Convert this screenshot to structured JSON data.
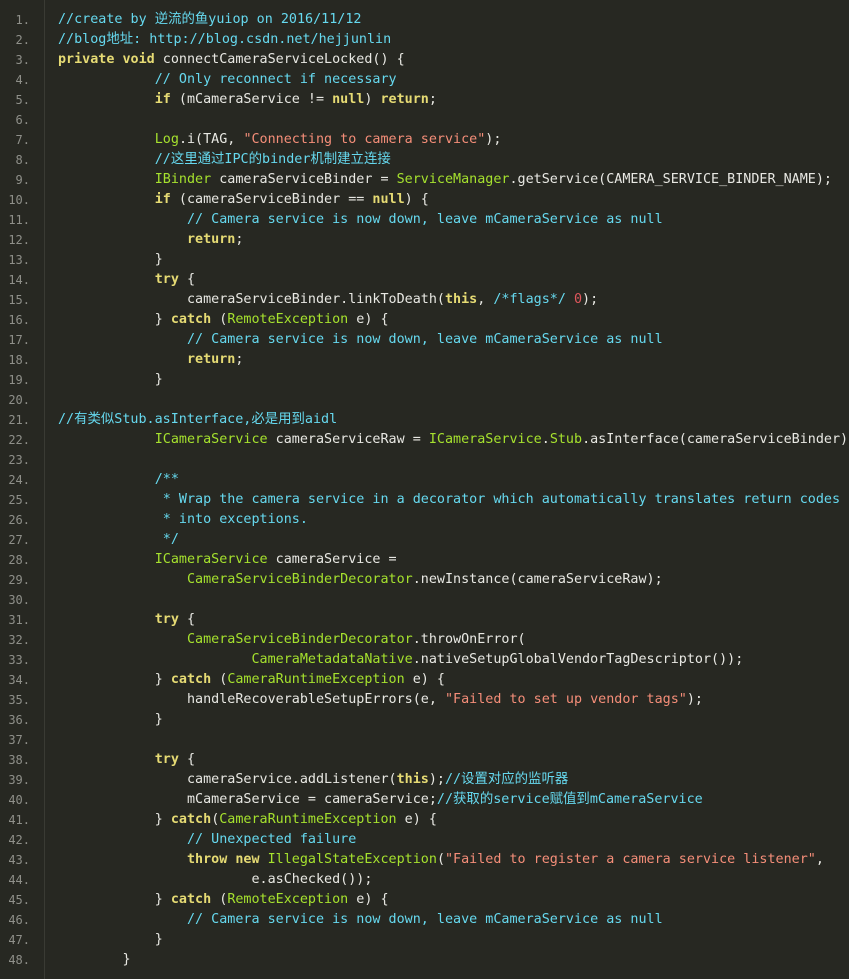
{
  "theme": {
    "background": "#272822",
    "line_number": "#8f908a",
    "plain": "#e8e8e3",
    "comment": "#66d9ef",
    "keyword": "#e6db74",
    "class_name": "#a6e22e",
    "string": "#f58e79",
    "number": "#e0575c"
  },
  "code": {
    "lines": [
      {
        "n": "1.",
        "tokens": [
          [
            "c",
            "//create by 逆流的鱼yuiop on 2016/11/12"
          ]
        ]
      },
      {
        "n": "2.",
        "tokens": [
          [
            "c",
            "//blog地址: http://blog.csdn.net/hejjunlin"
          ]
        ]
      },
      {
        "n": "3.",
        "tokens": [
          [
            "k",
            "private void"
          ],
          [
            "p",
            " connectCameraServiceLocked() {"
          ]
        ]
      },
      {
        "n": "4.",
        "tokens": [
          [
            "p",
            "            "
          ],
          [
            "c",
            "// Only reconnect if necessary"
          ]
        ]
      },
      {
        "n": "5.",
        "tokens": [
          [
            "p",
            "            "
          ],
          [
            "k",
            "if"
          ],
          [
            "p",
            " (mCameraService != "
          ],
          [
            "k",
            "null"
          ],
          [
            "p",
            ") "
          ],
          [
            "k",
            "return"
          ],
          [
            "p",
            ";"
          ]
        ]
      },
      {
        "n": "6.",
        "tokens": [
          [
            "p",
            ""
          ]
        ]
      },
      {
        "n": "7.",
        "tokens": [
          [
            "p",
            "            "
          ],
          [
            "n",
            "Log"
          ],
          [
            "p",
            ".i(TAG, "
          ],
          [
            "s",
            "\"Connecting to camera service\""
          ],
          [
            "p",
            ");"
          ]
        ]
      },
      {
        "n": "8.",
        "tokens": [
          [
            "p",
            "            "
          ],
          [
            "c",
            "//这里通过IPC的binder机制建立连接"
          ]
        ]
      },
      {
        "n": "9.",
        "tokens": [
          [
            "p",
            "            "
          ],
          [
            "n",
            "IBinder"
          ],
          [
            "p",
            " cameraServiceBinder = "
          ],
          [
            "n",
            "ServiceManager"
          ],
          [
            "p",
            ".getService(CAMERA_SERVICE_BINDER_NAME);"
          ]
        ]
      },
      {
        "n": "10.",
        "tokens": [
          [
            "p",
            "            "
          ],
          [
            "k",
            "if"
          ],
          [
            "p",
            " (cameraServiceBinder == "
          ],
          [
            "k",
            "null"
          ],
          [
            "p",
            ") {"
          ]
        ]
      },
      {
        "n": "11.",
        "tokens": [
          [
            "p",
            "                "
          ],
          [
            "c",
            "// Camera service is now down, leave mCameraService as null"
          ]
        ]
      },
      {
        "n": "12.",
        "tokens": [
          [
            "p",
            "                "
          ],
          [
            "k",
            "return"
          ],
          [
            "p",
            ";"
          ]
        ]
      },
      {
        "n": "13.",
        "tokens": [
          [
            "p",
            "            }"
          ]
        ]
      },
      {
        "n": "14.",
        "tokens": [
          [
            "p",
            "            "
          ],
          [
            "k",
            "try"
          ],
          [
            "p",
            " {"
          ]
        ]
      },
      {
        "n": "15.",
        "tokens": [
          [
            "p",
            "                cameraServiceBinder.linkToDeath("
          ],
          [
            "k",
            "this"
          ],
          [
            "p",
            ", "
          ],
          [
            "c",
            "/*flags*/"
          ],
          [
            "p",
            " "
          ],
          [
            "d",
            "0"
          ],
          [
            "p",
            ");"
          ]
        ]
      },
      {
        "n": "16.",
        "tokens": [
          [
            "p",
            "            } "
          ],
          [
            "k",
            "catch"
          ],
          [
            "p",
            " ("
          ],
          [
            "n",
            "RemoteException"
          ],
          [
            "p",
            " e) {"
          ]
        ]
      },
      {
        "n": "17.",
        "tokens": [
          [
            "p",
            "                "
          ],
          [
            "c",
            "// Camera service is now down, leave mCameraService as null"
          ]
        ]
      },
      {
        "n": "18.",
        "tokens": [
          [
            "p",
            "                "
          ],
          [
            "k",
            "return"
          ],
          [
            "p",
            ";"
          ]
        ]
      },
      {
        "n": "19.",
        "tokens": [
          [
            "p",
            "            }"
          ]
        ]
      },
      {
        "n": "20.",
        "tokens": [
          [
            "p",
            ""
          ]
        ]
      },
      {
        "n": "21.",
        "tokens": [
          [
            "c",
            "//有类似Stub.asInterface,必是用到aidl"
          ]
        ]
      },
      {
        "n": "22.",
        "tokens": [
          [
            "p",
            "            "
          ],
          [
            "n",
            "ICameraService"
          ],
          [
            "p",
            " cameraServiceRaw = "
          ],
          [
            "n",
            "ICameraService"
          ],
          [
            "p",
            "."
          ],
          [
            "n",
            "Stub"
          ],
          [
            "p",
            ".asInterface(cameraServiceBinder);"
          ]
        ]
      },
      {
        "n": "23.",
        "tokens": [
          [
            "p",
            ""
          ]
        ]
      },
      {
        "n": "24.",
        "tokens": [
          [
            "p",
            "            "
          ],
          [
            "c",
            "/**"
          ]
        ]
      },
      {
        "n": "25.",
        "tokens": [
          [
            "p",
            "            "
          ],
          [
            "c",
            " * Wrap the camera service in a decorator which automatically translates return codes"
          ]
        ]
      },
      {
        "n": "26.",
        "tokens": [
          [
            "p",
            "            "
          ],
          [
            "c",
            " * into exceptions."
          ]
        ]
      },
      {
        "n": "27.",
        "tokens": [
          [
            "p",
            "            "
          ],
          [
            "c",
            " */"
          ]
        ]
      },
      {
        "n": "28.",
        "tokens": [
          [
            "p",
            "            "
          ],
          [
            "n",
            "ICameraService"
          ],
          [
            "p",
            " cameraService ="
          ]
        ]
      },
      {
        "n": "29.",
        "tokens": [
          [
            "p",
            "                "
          ],
          [
            "n",
            "CameraServiceBinderDecorator"
          ],
          [
            "p",
            ".newInstance(cameraServiceRaw);"
          ]
        ]
      },
      {
        "n": "30.",
        "tokens": [
          [
            "p",
            ""
          ]
        ]
      },
      {
        "n": "31.",
        "tokens": [
          [
            "p",
            "            "
          ],
          [
            "k",
            "try"
          ],
          [
            "p",
            " {"
          ]
        ]
      },
      {
        "n": "32.",
        "tokens": [
          [
            "p",
            "                "
          ],
          [
            "n",
            "CameraServiceBinderDecorator"
          ],
          [
            "p",
            ".throwOnError("
          ]
        ]
      },
      {
        "n": "33.",
        "tokens": [
          [
            "p",
            "                        "
          ],
          [
            "n",
            "CameraMetadataNative"
          ],
          [
            "p",
            ".nativeSetupGlobalVendorTagDescriptor());"
          ]
        ]
      },
      {
        "n": "34.",
        "tokens": [
          [
            "p",
            "            } "
          ],
          [
            "k",
            "catch"
          ],
          [
            "p",
            " ("
          ],
          [
            "n",
            "CameraRuntimeException"
          ],
          [
            "p",
            " e) {"
          ]
        ]
      },
      {
        "n": "35.",
        "tokens": [
          [
            "p",
            "                handleRecoverableSetupErrors(e, "
          ],
          [
            "s",
            "\"Failed to set up vendor tags\""
          ],
          [
            "p",
            ");"
          ]
        ]
      },
      {
        "n": "36.",
        "tokens": [
          [
            "p",
            "            }"
          ]
        ]
      },
      {
        "n": "37.",
        "tokens": [
          [
            "p",
            ""
          ]
        ]
      },
      {
        "n": "38.",
        "tokens": [
          [
            "p",
            "            "
          ],
          [
            "k",
            "try"
          ],
          [
            "p",
            " {"
          ]
        ]
      },
      {
        "n": "39.",
        "tokens": [
          [
            "p",
            "                cameraService.addListener("
          ],
          [
            "k",
            "this"
          ],
          [
            "p",
            ");"
          ],
          [
            "c",
            "//设置对应的监听器"
          ]
        ]
      },
      {
        "n": "40.",
        "tokens": [
          [
            "p",
            "                mCameraService = cameraService;"
          ],
          [
            "c",
            "//获取的service赋值到mCameraService"
          ]
        ]
      },
      {
        "n": "41.",
        "tokens": [
          [
            "p",
            "            } "
          ],
          [
            "k",
            "catch"
          ],
          [
            "p",
            "("
          ],
          [
            "n",
            "CameraRuntimeException"
          ],
          [
            "p",
            " e) {"
          ]
        ]
      },
      {
        "n": "42.",
        "tokens": [
          [
            "p",
            "                "
          ],
          [
            "c",
            "// Unexpected failure"
          ]
        ]
      },
      {
        "n": "43.",
        "tokens": [
          [
            "p",
            "                "
          ],
          [
            "k",
            "throw new"
          ],
          [
            "p",
            " "
          ],
          [
            "n",
            "IllegalStateException"
          ],
          [
            "p",
            "("
          ],
          [
            "s",
            "\"Failed to register a camera service listener\""
          ],
          [
            "p",
            ","
          ]
        ]
      },
      {
        "n": "44.",
        "tokens": [
          [
            "p",
            "                        e.asChecked());"
          ]
        ]
      },
      {
        "n": "45.",
        "tokens": [
          [
            "p",
            "            } "
          ],
          [
            "k",
            "catch"
          ],
          [
            "p",
            " ("
          ],
          [
            "n",
            "RemoteException"
          ],
          [
            "p",
            " e) {"
          ]
        ]
      },
      {
        "n": "46.",
        "tokens": [
          [
            "p",
            "                "
          ],
          [
            "c",
            "// Camera service is now down, leave mCameraService as null"
          ]
        ]
      },
      {
        "n": "47.",
        "tokens": [
          [
            "p",
            "            }"
          ]
        ]
      },
      {
        "n": "48.",
        "tokens": [
          [
            "p",
            "        }"
          ]
        ]
      }
    ]
  }
}
